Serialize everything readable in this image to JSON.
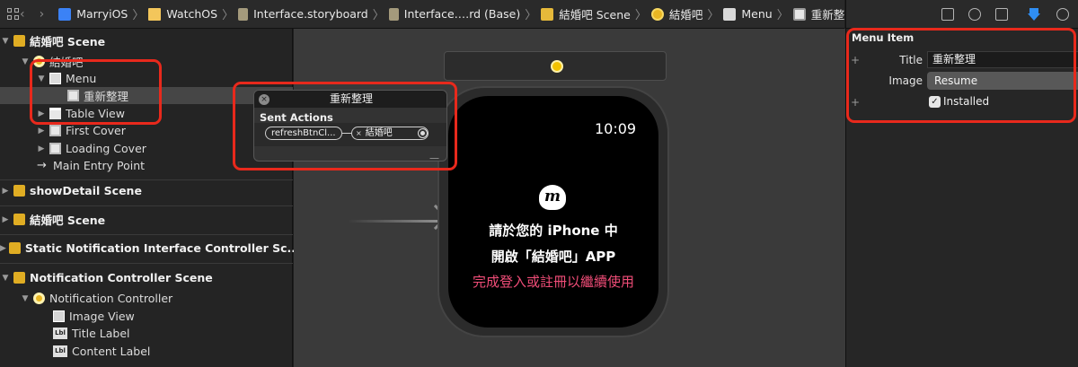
{
  "jump_bar": {
    "nav_back": "‹",
    "nav_forward": "›",
    "crumbs": [
      {
        "label": "MarryiOS",
        "icon": "swift-file-icon"
      },
      {
        "label": "WatchOS",
        "icon": "folder-icon"
      },
      {
        "label": "Interface.storyboard",
        "icon": "storyboard-icon"
      },
      {
        "label": "Interface.…rd (Base)",
        "icon": "storyboard-icon"
      },
      {
        "label": "結婚吧 Scene",
        "icon": "scene-icon"
      },
      {
        "label": "結婚吧",
        "icon": "controller-icon"
      },
      {
        "label": "Menu",
        "icon": "menu-icon"
      },
      {
        "label": "重新整理",
        "icon": "menu-item-icon"
      }
    ],
    "separator": "〉"
  },
  "outline": {
    "scene_1": {
      "label": "結婚吧 Scene"
    },
    "controller_1": {
      "label": "結婚吧"
    },
    "menu": {
      "label": "Menu"
    },
    "menu_item": {
      "label": "重新整理"
    },
    "table_view": {
      "label": "Table View"
    },
    "first_cover": {
      "label": "First Cover"
    },
    "loading_cover": {
      "label": "Loading Cover"
    },
    "main_entry": {
      "label": "Main Entry Point"
    },
    "scene_2": {
      "label": "showDetail Scene"
    },
    "scene_3": {
      "label": "結婚吧 Scene"
    },
    "scene_4": {
      "label": "Static Notification Interface Controller Sc..."
    },
    "scene_5": {
      "label": "Notification Controller Scene"
    },
    "notif_controller": {
      "label": "Notification Controller"
    },
    "image_view": {
      "label": "Image View"
    },
    "title_label": {
      "label": "Title Label"
    },
    "content_label": {
      "label": "Content Label"
    },
    "lbl_badge": "Lbl"
  },
  "connections_popup": {
    "title": "重新整理",
    "section": "Sent Actions",
    "action": "refreshBtnCl...",
    "target": "結婚吧",
    "close_glyph": "×"
  },
  "watch": {
    "time": "10:09",
    "logo_glyph": "m",
    "line_1": "請於您的 iPhone 中",
    "line_2": "開啟「結婚吧」APP",
    "line_3": "完成登入或註冊以繼續使用",
    "accent_color": "#f04d78"
  },
  "inspector": {
    "tabs": [
      "file-icon",
      "help-icon",
      "identity-icon",
      "attributes-icon",
      "connections-icon"
    ],
    "header": "Menu Item",
    "title_label": "Title",
    "title_value": "重新整理",
    "image_label": "Image",
    "image_value": "Resume",
    "installed_label": "Installed",
    "installed_checked": true,
    "plus_glyph": "+"
  },
  "colors": {
    "annotation_red": "#e8291c",
    "attributes_tab_blue": "#2f8ef3"
  }
}
